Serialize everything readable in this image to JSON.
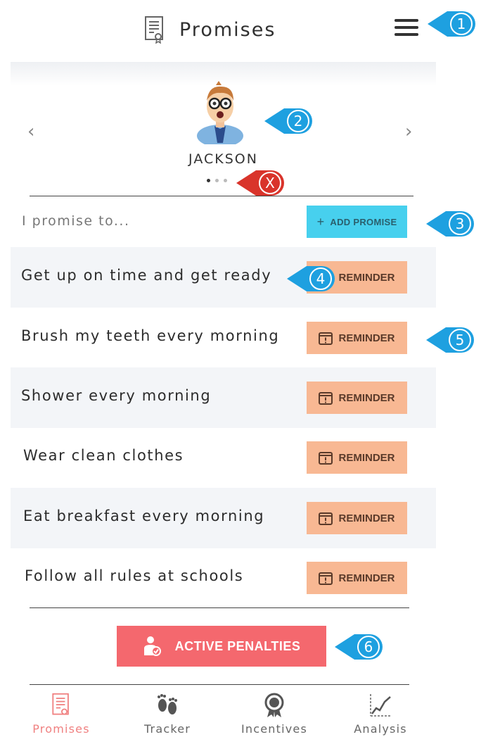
{
  "header": {
    "title": "Promises",
    "doc_icon": "certificate-icon",
    "menu_icon": "hamburger-icon"
  },
  "profile": {
    "name": "JACKSON",
    "avatar_icon": "child-avatar",
    "page_count": 3,
    "active_page": 1
  },
  "promises": {
    "intro": "I promise to...",
    "add_label": "ADD PROMISE",
    "reminder_label": "REMINDER",
    "items": [
      "Get up on time and get ready",
      "Brush my teeth every morning",
      "Shower every morning",
      "Wear clean clothes",
      "Eat breakfast every morning",
      "Follow all rules at schools"
    ]
  },
  "penalties": {
    "label": "ACTIVE PENALTIES"
  },
  "tabs": [
    {
      "label": "Promises",
      "icon": "certificate-icon",
      "active": true
    },
    {
      "label": "Tracker",
      "icon": "footprints-icon",
      "active": false
    },
    {
      "label": "Incentives",
      "icon": "award-badge-icon",
      "active": false
    },
    {
      "label": "Analysis",
      "icon": "line-chart-icon",
      "active": false
    }
  ],
  "callouts": {
    "c1": "1",
    "c2": "2",
    "cx": "X",
    "c3": "3",
    "c4": "4",
    "c5": "5",
    "c6": "6"
  },
  "colors": {
    "accent": "#47d0ee",
    "reminder": "#f8b893",
    "penalty": "#f4686e",
    "callout_blue": "#1ea0e0",
    "callout_red": "#d9342b",
    "active_tab": "#f08080"
  }
}
